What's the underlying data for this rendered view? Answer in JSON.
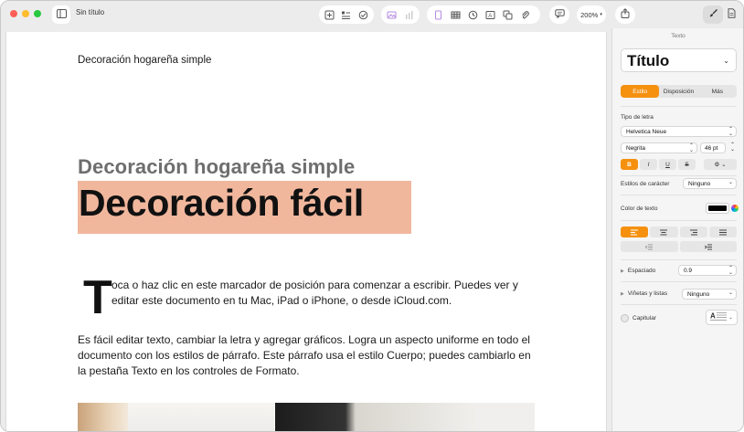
{
  "window": {
    "title": "Sin título",
    "zoom": "200%"
  },
  "toolbar": {
    "buttons": [
      {
        "name": "sidebar-toggle",
        "icon": "sidebar-icon"
      },
      {
        "name": "insert-page",
        "icon": "add-page-icon"
      },
      {
        "name": "insert-list",
        "icon": "list-icon"
      },
      {
        "name": "insert-check",
        "icon": "check-icon"
      },
      {
        "name": "insert-media",
        "icon": "media-icon"
      },
      {
        "name": "insert-chart-bars",
        "icon": "bars-icon"
      },
      {
        "name": "insert-text",
        "icon": "text-icon"
      },
      {
        "name": "insert-table",
        "icon": "table-icon"
      },
      {
        "name": "insert-chart",
        "icon": "clock-icon"
      },
      {
        "name": "insert-textbox",
        "icon": "textbox-icon"
      },
      {
        "name": "insert-shape",
        "icon": "shape-icon"
      },
      {
        "name": "insert-attachment",
        "icon": "paperclip-icon"
      },
      {
        "name": "comment",
        "icon": "comment-icon"
      },
      {
        "name": "share",
        "icon": "share-icon"
      },
      {
        "name": "format",
        "icon": "brush-icon"
      },
      {
        "name": "document",
        "icon": "document-icon"
      }
    ]
  },
  "document": {
    "header": "Decoración hogareña simple",
    "subtitle": "Decoración hogareña simple",
    "title": "Decoración fácil",
    "dropcap": "T",
    "paragraph1": "oca o haz clic en este marcador de posición para comenzar a escribir. Puedes ver y editar este documento en tu Mac, iPad o iPhone, o desde iCloud.com.",
    "paragraph2": "Es fácil editar texto, cambiar la letra y agregar gráficos. Logra un aspecto uniforme en todo el documento con los estilos de párrafo. Este párrafo usa el estilo Cuerpo; puedes cambiarlo en la pestaña Texto en los controles de Formato."
  },
  "inspector": {
    "section": "Texto",
    "paragraph_style": "Título",
    "tabs": [
      "Estilo",
      "Disposición",
      "Más"
    ],
    "active_tab": "Estilo",
    "font_label": "Tipo de letra",
    "font_family": "Helvetica Neue",
    "font_weight": "Negrita",
    "font_size": "46 pt",
    "style_buttons": [
      "B",
      "I",
      "U",
      "S"
    ],
    "char_styles_label": "Estilos de carácter",
    "char_styles_value": "Ninguno",
    "text_color_label": "Color de texto",
    "text_color": "#000000",
    "accent": "#f5910f",
    "spacing_label": "Espaciado",
    "spacing_value": "0.9",
    "bullets_label": "Viñetas y listas",
    "bullets_value": "Ninguno",
    "dropcap_label": "Capitular"
  }
}
